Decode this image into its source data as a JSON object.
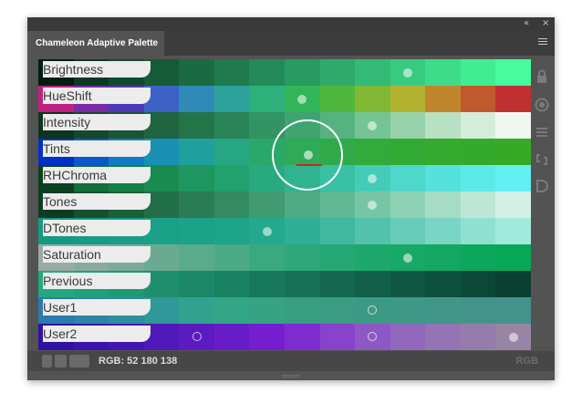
{
  "panel": {
    "tab_title": "Chameleon Adaptive Palette",
    "collapse_glyph": "«",
    "close_glyph": "×",
    "menu_icon": "hamburger-menu-icon"
  },
  "rows": [
    {
      "label": "Brightness",
      "colors": [
        "#001e10",
        "#0a3a24",
        "#104b2f",
        "#155a39",
        "#1a6a43",
        "#1f7a4d",
        "#248a57",
        "#299a61",
        "#2eab6b",
        "#33bb75",
        "#38cb7f",
        "#3ddc89",
        "#42ec93",
        "#47fc9d"
      ]
    },
    {
      "label": "HueShift",
      "colors": [
        "#c02080",
        "#7a2ca6",
        "#4e3ab8",
        "#3b62c4",
        "#2f8ab6",
        "#2da29c",
        "#2eb07a",
        "#32b458",
        "#4eb63c",
        "#80b834",
        "#b2b230",
        "#c0862e",
        "#c05a2c",
        "#c03030"
      ]
    },
    {
      "label": "Intensity",
      "colors": [
        "#0e3420",
        "#15482c",
        "#1a5636",
        "#1f6440",
        "#24744a",
        "#2a8456",
        "#329462",
        "#3ea470",
        "#55b380",
        "#76c394",
        "#98d2aa",
        "#b8e0c2",
        "#d4eddb",
        "#eef8f1"
      ]
    },
    {
      "label": "Tints",
      "colors": [
        "#0030c8",
        "#0a58cc",
        "#137ac4",
        "#1a90b4",
        "#20a09c",
        "#26a682",
        "#2aa86a",
        "#2eaa58",
        "#30aa48",
        "#32aa3c",
        "#33aa34",
        "#34aa2e",
        "#35aa2a",
        "#36aa26"
      ]
    },
    {
      "label": "RHChroma",
      "colors": [
        "#0c4020",
        "#127038",
        "#168044",
        "#1a8c52",
        "#1e9660",
        "#22a06e",
        "#28aa7e",
        "#30b490",
        "#3ac0a4",
        "#44ccb8",
        "#4ed8cc",
        "#56e2dc",
        "#5ceae8",
        "#62f0f4"
      ]
    },
    {
      "label": "Tones",
      "colors": [
        "#0e3c22",
        "#16502e",
        "#1c603a",
        "#226e46",
        "#2a7c54",
        "#348a62",
        "#409a72",
        "#4eaa84",
        "#60b894",
        "#76c6a6",
        "#8ed2b6",
        "#a6dcc6",
        "#bde6d6",
        "#d4f0e6"
      ]
    },
    {
      "label": "DTones",
      "colors": [
        "#149a80",
        "#169c82",
        "#189e84",
        "#1aa086",
        "#1ca288",
        "#1ea48a",
        "#24a88e",
        "#30ae96",
        "#40b8a0",
        "#52c2ac",
        "#66ccb8",
        "#7ad6c4",
        "#8ee0d0",
        "#a2eadc"
      ]
    },
    {
      "label": "Saturation",
      "colors": [
        "#9aaaa4",
        "#8aaa9e",
        "#7aaa98",
        "#6aaa92",
        "#5aaa8c",
        "#4aaa86",
        "#3aa880",
        "#2ea87a",
        "#26a874",
        "#1ea86e",
        "#18a868",
        "#12a862",
        "#0ca85c",
        "#06a856"
      ]
    },
    {
      "label": "Previous",
      "colors": [
        "#24a880",
        "#22a07a",
        "#209874",
        "#1e906e",
        "#1c8868",
        "#1a8062",
        "#18785c",
        "#167056",
        "#146850",
        "#12604a",
        "#105844",
        "#0e503e",
        "#0c4838",
        "#0a4032"
      ]
    },
    {
      "label": "User1",
      "colors": [
        "#2a7ab0",
        "#2c84a8",
        "#2e8ea0",
        "#309898",
        "#32a290",
        "#34a688",
        "#36a482",
        "#389e80",
        "#3a9c82",
        "#3c9a84",
        "#3e9886",
        "#409688",
        "#42948a",
        "#44928c"
      ]
    },
    {
      "label": "User2",
      "colors": [
        "#3012a0",
        "#3a14a8",
        "#4416b0",
        "#5018b8",
        "#5c1ac0",
        "#681cc8",
        "#741ed0",
        "#7e2cd0",
        "#8842cc",
        "#8e58c4",
        "#9268bc",
        "#9474b4",
        "#967cac",
        "#9884a4"
      ]
    }
  ],
  "status": {
    "rgb_readout": "RGB: 52 180 138",
    "mode_label": "RGB"
  },
  "side_icons": [
    "lock-icon",
    "target-icon",
    "list-icon",
    "link-icon",
    "d-icon"
  ]
}
